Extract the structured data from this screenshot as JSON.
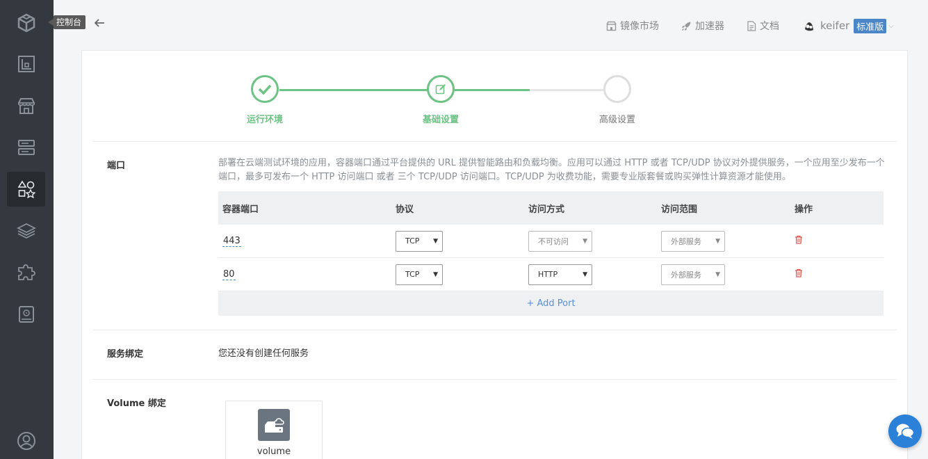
{
  "sidebar": {
    "tooltip": "控制台",
    "items": [
      {
        "icon": "logo-cube-icon"
      },
      {
        "icon": "document-icon"
      },
      {
        "icon": "store-icon"
      },
      {
        "icon": "server-icon"
      },
      {
        "icon": "shapes-icon",
        "active": true
      },
      {
        "icon": "layers-icon"
      },
      {
        "icon": "puzzle-icon"
      },
      {
        "icon": "disk-icon"
      },
      {
        "icon": "user-icon"
      }
    ]
  },
  "topnav": {
    "mirror_market": "镜像市场",
    "accelerator": "加速器",
    "docs": "文档",
    "username": "keifer",
    "plan_badge": "标准版"
  },
  "steps": [
    {
      "label": "运行环境",
      "state": "done"
    },
    {
      "label": "基础设置",
      "state": "current"
    },
    {
      "label": "高级设置",
      "state": "todo"
    }
  ],
  "ports": {
    "title": "端口",
    "description": "部署在云端测试环境的应用，容器端口通过平台提供的 URL 提供智能路由和负载均衡。应用可以通过 HTTP 或者 TCP/UDP 协议对外提供服务，一个应用至少发布一个端口，最多可发布一个 HTTP 访问端口 或者 三个 TCP/UDP 访问端口。TCP/UDP 为收费功能，需要专业版套餐或购买弹性计算资源才能使用。",
    "headers": [
      "容器端口",
      "协议",
      "访问方式",
      "访问范围",
      "操作"
    ],
    "rows": [
      {
        "port": "443",
        "protocol": "TCP",
        "access": "不可访问",
        "scope": "外部服务"
      },
      {
        "port": "80",
        "protocol": "TCP",
        "access": "HTTP",
        "scope": "外部服务"
      }
    ],
    "add_label": "+ Add Port"
  },
  "service": {
    "title": "服务绑定",
    "empty_text": "您还没有创建任何服务"
  },
  "volume": {
    "title": "Volume 绑定",
    "card_label": "volume"
  },
  "colors": {
    "sidebar_bg": "#33393f",
    "accent_green": "#6cc383",
    "link_blue": "#5b8fd4",
    "delete_red": "#e05a4f"
  }
}
